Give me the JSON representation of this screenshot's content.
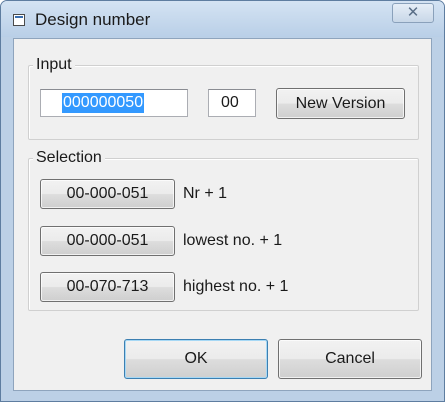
{
  "window": {
    "title": "Design number",
    "close_glyph": "✕"
  },
  "input_group": {
    "label": "Input",
    "number_value": "000000050",
    "version_value": "00",
    "new_version_label": "New Version"
  },
  "selection_group": {
    "label": "Selection",
    "rows": [
      {
        "button": "00-000-051",
        "description": "Nr + 1"
      },
      {
        "button": "00-000-051",
        "description": "lowest no. + 1"
      },
      {
        "button": "00-070-713",
        "description": "highest no. + 1"
      }
    ]
  },
  "footer": {
    "ok_label": "OK",
    "cancel_label": "Cancel"
  },
  "colors": {
    "selection_highlight": "#3399ff",
    "frame": "#bcd0e6",
    "dialog_background": "#f0f0f0",
    "default_button_border": "#3c7fb1"
  }
}
